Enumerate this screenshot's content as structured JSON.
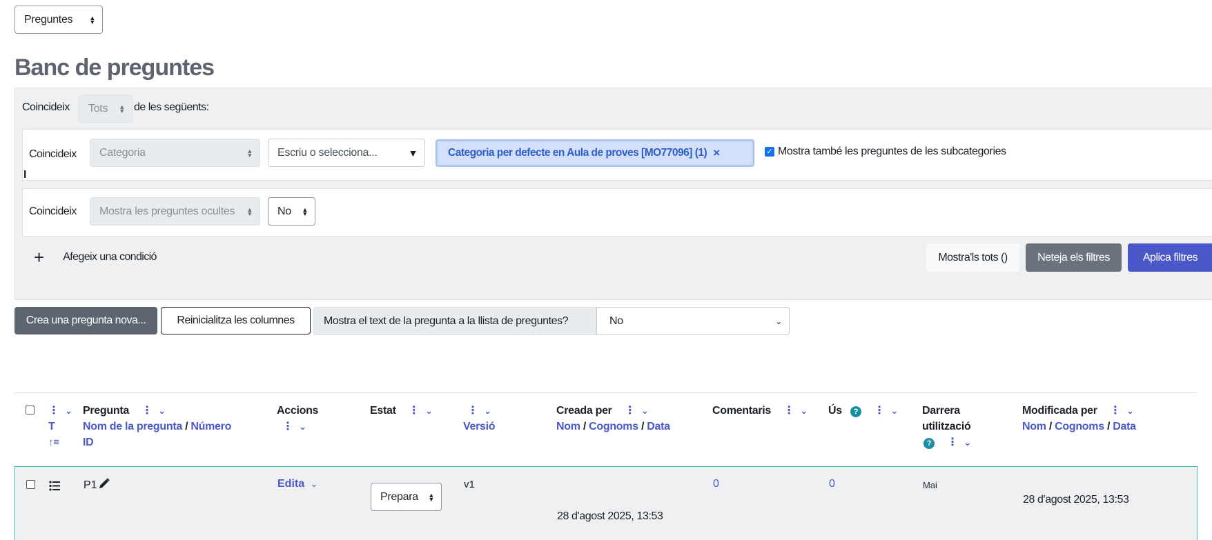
{
  "nav_select": {
    "value": "Preguntes"
  },
  "page_title": "Banc de preguntes",
  "filters": {
    "match_label": "Coincideix",
    "match_value": "Tots",
    "match_suffix": "de les següents:",
    "condition1": {
      "match_label": "Coincideix",
      "type_value": "Categoria",
      "search_placeholder": "Escriu o selecciona...",
      "chip_label": "Categoria per defecte en Aula de proves [MO77096] (1)",
      "chip_remove": "×",
      "subcategories_label": "Mostra també les preguntes de les subcategories",
      "subcategories_checked": true
    },
    "join_label": "I",
    "condition2": {
      "match_label": "Coincideix",
      "type_value": "Mostra les preguntes ocultes",
      "value": "No"
    },
    "add_condition_icon": "+",
    "add_condition_label": "Afegeix una condició",
    "show_all_label": "Mostra'ls tots ()",
    "clear_label": "Neteja els filtres",
    "apply_label": "Aplica filtres"
  },
  "toolbar": {
    "create_label": "Crea una pregunta nova...",
    "reset_columns_label": "Reinicialitza les columnes",
    "show_text_label": "Mostra el text de la pregunta a la llista de preguntes?",
    "show_text_value": "No"
  },
  "table": {
    "headers": {
      "type_label": "T",
      "type_sort": "↑≡",
      "question": "Pregunta",
      "question_sub1": "Nom de la pregunta",
      "question_sep": " / ",
      "question_sub2": "Número",
      "question_sub3": "ID",
      "actions": "Accions",
      "status": "Estat",
      "version": "Versió",
      "created_by": "Creada per",
      "name": "Nom",
      "surname": "Cognoms",
      "date": "Data",
      "comments": "Comentaris",
      "usage": "Ús",
      "last_used_1": "Darrera",
      "last_used_2": "utilització",
      "modified_by": "Modificada per",
      "kebab": "⋮",
      "chevron": "⌄",
      "help": "?",
      "slash": "/"
    },
    "rows": [
      {
        "name": "P1",
        "actions": "Edita",
        "status": "Prepara",
        "version": "v1",
        "created": "28 d'agost 2025, 13:53",
        "comments": "0",
        "usage": "0",
        "last_used": "Mai",
        "modified": "28 d'agost 2025, 13:53"
      }
    ]
  },
  "colors": {
    "primary": "#4a58c8",
    "secondary": "#6a737b",
    "dark": "#343a40",
    "help": "#1b8ea0",
    "panel": "#eff0f2",
    "row_border": "#3fb6b0"
  }
}
